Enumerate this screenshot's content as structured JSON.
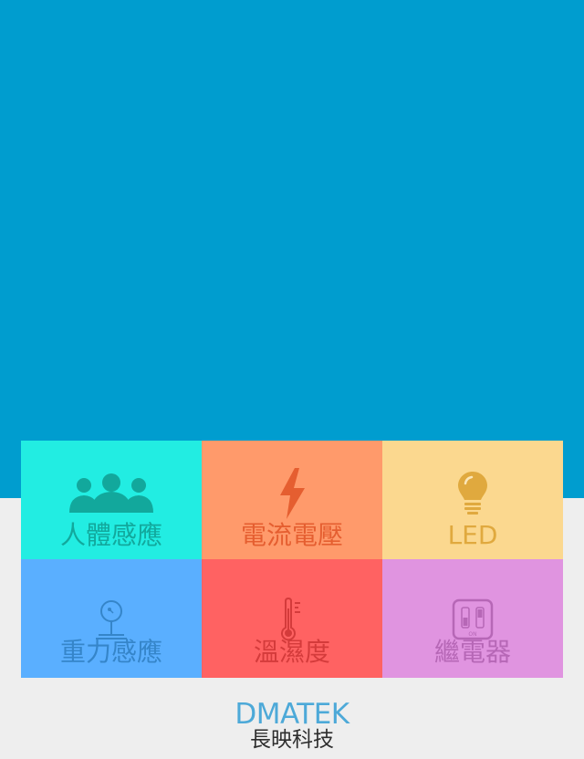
{
  "header": {
    "background_color": "#009dcf"
  },
  "tiles": [
    {
      "label": "人體感應",
      "icon": "people-group-icon",
      "bg": "#22ede2",
      "fg": "#12a89c"
    },
    {
      "label": "電流電壓",
      "icon": "lightning-bolt-icon",
      "bg": "#ff9a6b",
      "fg": "#e55e30"
    },
    {
      "label": "LED",
      "icon": "light-bulb-icon",
      "bg": "#fbd88f",
      "fg": "#e0a93e"
    },
    {
      "label": "重力感應",
      "icon": "joystick-icon",
      "bg": "#5aafff",
      "fg": "#3585c9"
    },
    {
      "label": "溫濕度",
      "icon": "thermometer-icon",
      "bg": "#ff6262",
      "fg": "#d43b3b"
    },
    {
      "label": "繼電器",
      "icon": "relay-switch-icon",
      "bg": "#e094e0",
      "fg": "#b667b6"
    }
  ],
  "brand": {
    "name_en": "DMATEK",
    "name_zh": "長映科技",
    "color": "#4da9d8"
  },
  "relay_icon_text": "ON"
}
